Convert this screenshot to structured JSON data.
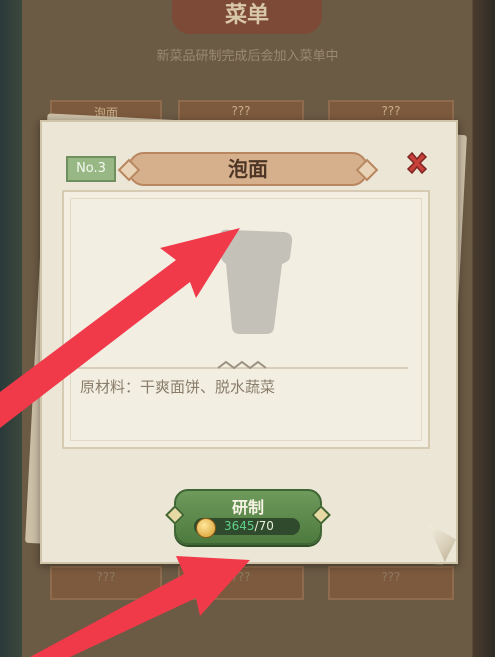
{
  "background": {
    "title": "菜单",
    "subtitle": "新菜品研制完成后会加入菜单中",
    "cards_top": [
      "泡面",
      "???",
      "???"
    ],
    "cards_bottom": [
      "???",
      "???",
      "???"
    ]
  },
  "dialog": {
    "number_badge": "No.3",
    "dish_name": "泡面",
    "ingredients_prefix": "原材料：",
    "ingredients": "干爽面饼、脱水蔬菜"
  },
  "research_button": {
    "label": "研制",
    "owned": "3645",
    "required": "/70"
  },
  "colors": {
    "arrow": "#f03a4a",
    "button_green": "#5a8a4a",
    "owned_amount": "#5fd08a",
    "close_red": "#c8403a"
  },
  "icons": {
    "close": "close-x-icon",
    "coin": "coin-icon",
    "dish": "noodle-cup-silhouette-icon"
  }
}
